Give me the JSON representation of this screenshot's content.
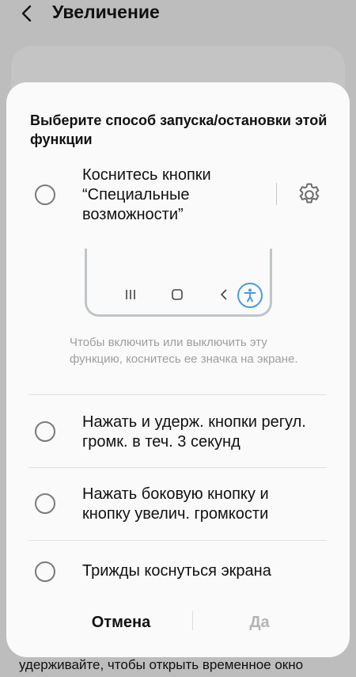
{
  "app_bar": {
    "title": "Увеличение",
    "back_icon": "chevron-left-icon"
  },
  "background": {
    "bottom_text": "удерживайте, чтобы открыть временное окно"
  },
  "dialog": {
    "title": "Выберите способ запуска/остановки этой функции",
    "options": [
      {
        "label": "Коснитесь кнопки “Специальные возможности”",
        "selected": false
      },
      {
        "label": "Нажать и удерж. кнопки регул. громк. в теч. 3 секунд",
        "selected": false
      },
      {
        "label": "Нажать боковую кнопку и кнопку увелич. громкости",
        "selected": false
      },
      {
        "label": "Трижды коснуться экрана",
        "selected": false
      }
    ],
    "settings_icon": "gear-icon",
    "nav_icons": [
      "recents-icon",
      "home-icon",
      "back-icon",
      "accessibility-icon"
    ],
    "hint": "Чтобы включить или выключить эту функцию, коснитесь ее значка на экране.",
    "buttons": {
      "cancel": "Отмена",
      "ok": "Да"
    },
    "colors": {
      "accent": "#4a9be0",
      "disabled_text": "#b5b5b5",
      "hint_text": "#9e9e9e"
    }
  }
}
